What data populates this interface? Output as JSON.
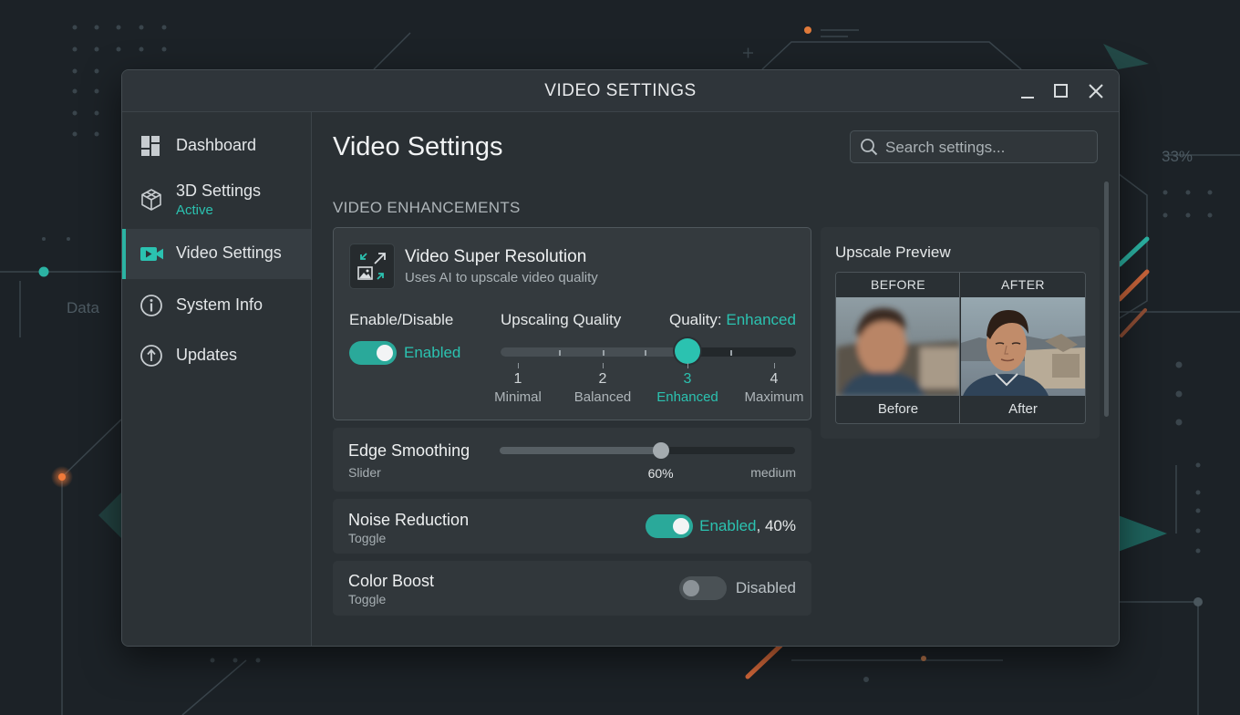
{
  "colors": {
    "accent": "#2bc2b0",
    "accent_track": "#2aa99a",
    "background": "#1c2227",
    "window": "#2a3034",
    "decor_orange": "#e0703a"
  },
  "background": {
    "percent_label": "33%",
    "data_label": "Data"
  },
  "window": {
    "title": "VIDEO SETTINGS",
    "controls": [
      "minimize-icon",
      "maximize-icon",
      "close-icon"
    ]
  },
  "sidebar": {
    "items": [
      {
        "label": "Dashboard",
        "icon": "dashboard-icon"
      },
      {
        "label": "3D Settings",
        "sublabel": "Active",
        "icon": "cube-icon"
      },
      {
        "label": "Video Settings",
        "icon": "video-camera-icon",
        "selected": true
      },
      {
        "label": "System Info",
        "icon": "info-icon"
      },
      {
        "label": "Updates",
        "icon": "update-arrow-icon"
      }
    ]
  },
  "main": {
    "title": "Video Settings",
    "search_placeholder": "Search settings...",
    "section_heading": "VIDEO ENHANCEMENTS"
  },
  "vsr": {
    "icon": "expand-image-icon",
    "title": "Video Super Resolution",
    "description": "Uses AI to upscale video quality",
    "enable_label": "Enable/Disable",
    "toggle_state": "Enabled",
    "toggle_on": true,
    "quality_label": "Upscaling Quality",
    "quality_prefix": "Quality:",
    "quality_value": "Enhanced",
    "selected_level": 3,
    "levels": [
      {
        "num": "1",
        "name": "Minimal"
      },
      {
        "num": "2",
        "name": "Balanced"
      },
      {
        "num": "3",
        "name": "Enhanced"
      },
      {
        "num": "4",
        "name": "Maximum"
      }
    ]
  },
  "edge_smoothing": {
    "title": "Edge Smoothing",
    "type": "Slider",
    "value": 0.6,
    "value_label": "60%",
    "level_label": "medium"
  },
  "noise_reduction": {
    "title": "Noise Reduction",
    "type": "Toggle",
    "state": "Enabled",
    "amount": ", 40%",
    "on": true
  },
  "color_boost": {
    "title": "Color Boost",
    "type": "Toggle",
    "state": "Disabled",
    "on": false
  },
  "preview": {
    "title": "Upscale Preview",
    "before_header": "BEFORE",
    "after_header": "AFTER",
    "before_caption": "Before",
    "after_caption": "After"
  }
}
